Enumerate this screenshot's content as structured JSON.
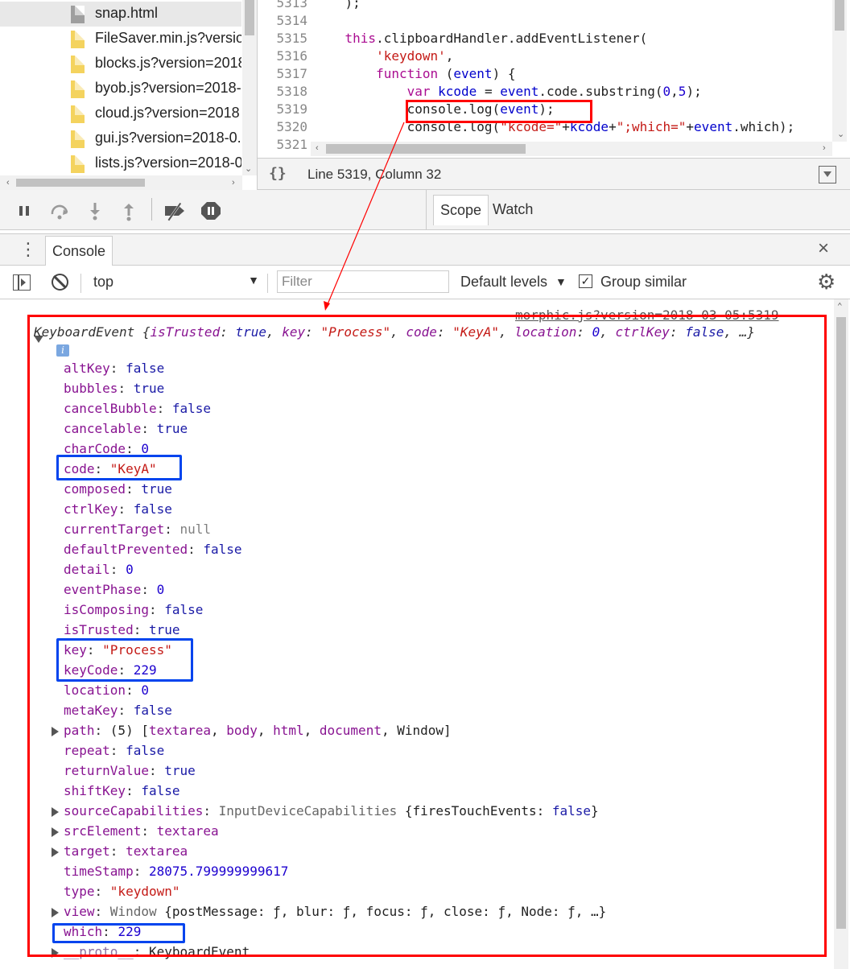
{
  "navigator": {
    "files": [
      {
        "name": "snap.html",
        "type": "html",
        "selected": true
      },
      {
        "name": "FileSaver.min.js?versio",
        "type": "js"
      },
      {
        "name": "blocks.js?version=2018",
        "type": "js"
      },
      {
        "name": "byob.js?version=2018-",
        "type": "js"
      },
      {
        "name": "cloud.js?version=2018",
        "type": "js"
      },
      {
        "name": "gui.js?version=2018-0.",
        "type": "js"
      },
      {
        "name": "lists.js?version=2018-0",
        "type": "js"
      }
    ]
  },
  "editor": {
    "lines": [
      {
        "n": "5313",
        "segs": [
          {
            "t": "    );",
            "c": ""
          }
        ]
      },
      {
        "n": "5314",
        "segs": [
          {
            "t": "",
            "c": ""
          }
        ]
      },
      {
        "n": "5315",
        "segs": [
          {
            "t": "    ",
            "c": ""
          },
          {
            "t": "this",
            "c": "kw"
          },
          {
            "t": ".clipboardHandler.addEventListener(",
            "c": ""
          }
        ]
      },
      {
        "n": "5316",
        "segs": [
          {
            "t": "        ",
            "c": ""
          },
          {
            "t": "'keydown'",
            "c": "str"
          },
          {
            "t": ",",
            "c": ""
          }
        ]
      },
      {
        "n": "5317",
        "segs": [
          {
            "t": "        ",
            "c": ""
          },
          {
            "t": "function",
            "c": "kw"
          },
          {
            "t": " (",
            "c": ""
          },
          {
            "t": "event",
            "c": "vname"
          },
          {
            "t": ") {",
            "c": ""
          }
        ]
      },
      {
        "n": "5318",
        "segs": [
          {
            "t": "            ",
            "c": ""
          },
          {
            "t": "var",
            "c": "kw"
          },
          {
            "t": " ",
            "c": ""
          },
          {
            "t": "kcode",
            "c": "vname"
          },
          {
            "t": " = ",
            "c": ""
          },
          {
            "t": "event",
            "c": "vname"
          },
          {
            "t": ".code.substring(",
            "c": ""
          },
          {
            "t": "0",
            "c": "num"
          },
          {
            "t": ",",
            "c": ""
          },
          {
            "t": "5",
            "c": "num"
          },
          {
            "t": ");",
            "c": ""
          }
        ]
      },
      {
        "n": "5319",
        "segs": [
          {
            "t": "            console.log(",
            "c": ""
          },
          {
            "t": "event",
            "c": "vname"
          },
          {
            "t": ");",
            "c": ""
          }
        ]
      },
      {
        "n": "5320",
        "segs": [
          {
            "t": "            console.log(",
            "c": ""
          },
          {
            "t": "\"kcode=\"",
            "c": "str"
          },
          {
            "t": "+",
            "c": ""
          },
          {
            "t": "kcode",
            "c": "vname"
          },
          {
            "t": "+",
            "c": ""
          },
          {
            "t": "\";which=\"",
            "c": "str"
          },
          {
            "t": "+",
            "c": ""
          },
          {
            "t": "event",
            "c": "vname"
          },
          {
            "t": ".which);",
            "c": ""
          }
        ]
      },
      {
        "n": "5321",
        "segs": [
          {
            "t": "",
            "c": ""
          }
        ]
      }
    ],
    "status": "Line 5319, Column 32",
    "braces_icon": "{}"
  },
  "debugger_toolbar": {
    "buttons": [
      "pause-icon",
      "step-over-icon",
      "step-into-icon",
      "step-out-icon",
      "deactivate-breakpoints-icon",
      "pause-on-exceptions-icon"
    ]
  },
  "sidebar_tabs": [
    "Scope",
    "Watch"
  ],
  "drawer": {
    "tab": "Console",
    "close": "×"
  },
  "console_toolbar": {
    "context": "top",
    "filter_placeholder": "Filter",
    "levels": "Default levels",
    "group_similar": "Group similar",
    "group_checked": true
  },
  "console": {
    "source": "morphic.js?version=2018-03-05:5319",
    "summary": {
      "class": "KeyboardEvent",
      "text_segs": [
        {
          "t": " {",
          "c": ""
        },
        {
          "t": "isTrusted",
          "c": "prop-key"
        },
        {
          "t": ": ",
          "c": ""
        },
        {
          "t": "true",
          "c": "pval-bool"
        },
        {
          "t": ", ",
          "c": ""
        },
        {
          "t": "key",
          "c": "prop-key"
        },
        {
          "t": ": ",
          "c": ""
        },
        {
          "t": "\"Process\"",
          "c": "pval-str"
        },
        {
          "t": ", ",
          "c": ""
        },
        {
          "t": "code",
          "c": "prop-key"
        },
        {
          "t": ": ",
          "c": ""
        },
        {
          "t": "\"KeyA\"",
          "c": "pval-str"
        },
        {
          "t": ", ",
          "c": ""
        },
        {
          "t": "location",
          "c": "prop-key"
        },
        {
          "t": ": ",
          "c": ""
        },
        {
          "t": "0",
          "c": "pval-num"
        },
        {
          "t": ", ",
          "c": ""
        },
        {
          "t": "ctrlKey",
          "c": "prop-key"
        },
        {
          "t": ": ",
          "c": ""
        },
        {
          "t": "false",
          "c": "pval-bool"
        },
        {
          "t": ", …}",
          "c": ""
        }
      ]
    },
    "properties": [
      {
        "k": "altKey",
        "segs": [
          {
            "t": "false",
            "c": "pval-bool"
          }
        ]
      },
      {
        "k": "bubbles",
        "segs": [
          {
            "t": "true",
            "c": "pval-bool"
          }
        ]
      },
      {
        "k": "cancelBubble",
        "segs": [
          {
            "t": "false",
            "c": "pval-bool"
          }
        ]
      },
      {
        "k": "cancelable",
        "segs": [
          {
            "t": "true",
            "c": "pval-bool"
          }
        ]
      },
      {
        "k": "charCode",
        "segs": [
          {
            "t": "0",
            "c": "pval-num"
          }
        ]
      },
      {
        "k": "code",
        "segs": [
          {
            "t": "\"KeyA\"",
            "c": "pval-str"
          }
        ]
      },
      {
        "k": "composed",
        "segs": [
          {
            "t": "true",
            "c": "pval-bool"
          }
        ]
      },
      {
        "k": "ctrlKey",
        "segs": [
          {
            "t": "false",
            "c": "pval-bool"
          }
        ]
      },
      {
        "k": "currentTarget",
        "segs": [
          {
            "t": "null",
            "c": "pval-null"
          }
        ]
      },
      {
        "k": "defaultPrevented",
        "segs": [
          {
            "t": "false",
            "c": "pval-bool"
          }
        ]
      },
      {
        "k": "detail",
        "segs": [
          {
            "t": "0",
            "c": "pval-num"
          }
        ]
      },
      {
        "k": "eventPhase",
        "segs": [
          {
            "t": "0",
            "c": "pval-num"
          }
        ]
      },
      {
        "k": "isComposing",
        "segs": [
          {
            "t": "false",
            "c": "pval-bool"
          }
        ]
      },
      {
        "k": "isTrusted",
        "segs": [
          {
            "t": "true",
            "c": "pval-bool"
          }
        ]
      },
      {
        "k": "key",
        "segs": [
          {
            "t": "\"Process\"",
            "c": "pval-str"
          }
        ]
      },
      {
        "k": "keyCode",
        "segs": [
          {
            "t": "229",
            "c": "pval-num"
          }
        ]
      },
      {
        "k": "location",
        "segs": [
          {
            "t": "0",
            "c": "pval-num"
          }
        ]
      },
      {
        "k": "metaKey",
        "segs": [
          {
            "t": "false",
            "c": "pval-bool"
          }
        ]
      },
      {
        "k": "path",
        "expandable": true,
        "segs": [
          {
            "t": "(5) [",
            "c": "pval-obj"
          },
          {
            "t": "textarea",
            "c": "prop-key"
          },
          {
            "t": ", ",
            "c": "pval-obj"
          },
          {
            "t": "body",
            "c": "prop-key"
          },
          {
            "t": ", ",
            "c": "pval-obj"
          },
          {
            "t": "html",
            "c": "prop-key"
          },
          {
            "t": ", ",
            "c": "pval-obj"
          },
          {
            "t": "document",
            "c": "prop-key"
          },
          {
            "t": ", Window]",
            "c": "pval-obj"
          }
        ]
      },
      {
        "k": "repeat",
        "segs": [
          {
            "t": "false",
            "c": "pval-bool"
          }
        ]
      },
      {
        "k": "returnValue",
        "segs": [
          {
            "t": "true",
            "c": "pval-bool"
          }
        ]
      },
      {
        "k": "shiftKey",
        "segs": [
          {
            "t": "false",
            "c": "pval-bool"
          }
        ]
      },
      {
        "k": "sourceCapabilities",
        "expandable": true,
        "segs": [
          {
            "t": "InputDeviceCapabilities",
            "c": "pval-class"
          },
          {
            "t": " {firesTouchEvents: ",
            "c": "pval-obj"
          },
          {
            "t": "false",
            "c": "pval-bool"
          },
          {
            "t": "}",
            "c": "pval-obj"
          }
        ]
      },
      {
        "k": "srcElement",
        "expandable": true,
        "segs": [
          {
            "t": "textarea",
            "c": "prop-key"
          }
        ]
      },
      {
        "k": "target",
        "expandable": true,
        "segs": [
          {
            "t": "textarea",
            "c": "prop-key"
          }
        ]
      },
      {
        "k": "timeStamp",
        "segs": [
          {
            "t": "28075.799999999617",
            "c": "pval-num"
          }
        ]
      },
      {
        "k": "type",
        "segs": [
          {
            "t": "\"keydown\"",
            "c": "pval-str"
          }
        ]
      },
      {
        "k": "view",
        "expandable": true,
        "segs": [
          {
            "t": "Window",
            "c": "pval-class"
          },
          {
            "t": " {postMessage: ƒ, blur: ƒ, focus: ƒ, close: ƒ, Node: ƒ, …}",
            "c": "pval-obj"
          }
        ]
      },
      {
        "k": "which",
        "segs": [
          {
            "t": "229",
            "c": "pval-num"
          }
        ]
      },
      {
        "k": "__proto__",
        "expandable": true,
        "dim": true,
        "segs": [
          {
            "t": "KeyboardEvent",
            "c": "pval-obj"
          }
        ]
      }
    ]
  },
  "colors": {
    "annotation_red": "#ff0000",
    "annotation_blue": "#0044ee"
  }
}
